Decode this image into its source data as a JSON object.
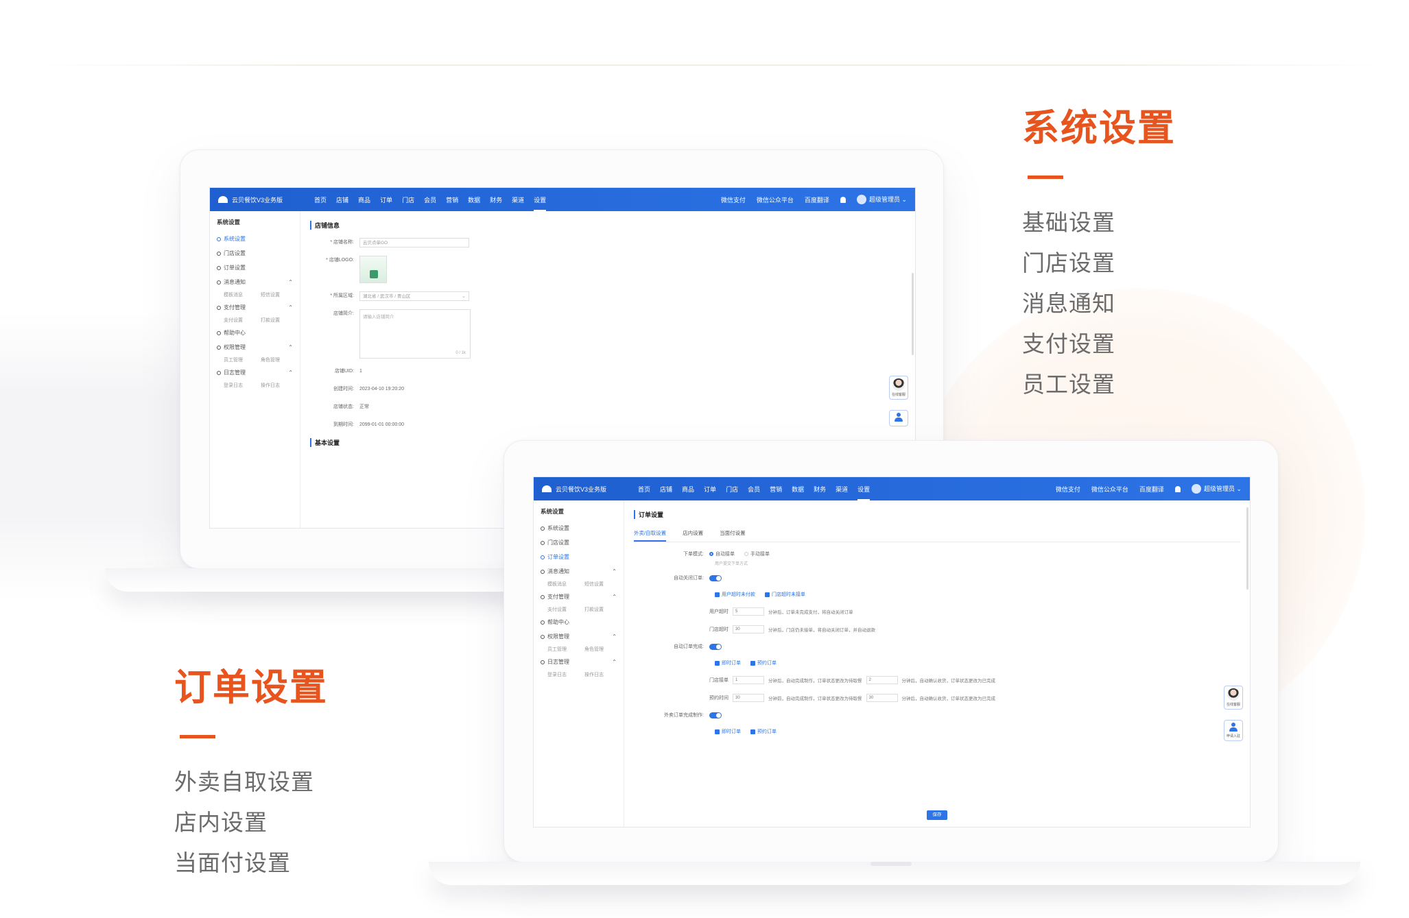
{
  "system_feature": {
    "title": "系统设置",
    "items": [
      "基础设置",
      "门店设置",
      "消息通知",
      "支付设置",
      "员工设置"
    ]
  },
  "order_feature": {
    "title": "订单设置",
    "items": [
      "外卖自取设置",
      "店内设置",
      "当面付设置"
    ]
  },
  "app": {
    "name": "云贝餐饮V3业务版",
    "menu": [
      "首页",
      "店铺",
      "商品",
      "订单",
      "门店",
      "会员",
      "营销",
      "数据",
      "财务",
      "渠道",
      "设置"
    ],
    "active_menu": "设置",
    "right_links": [
      "微信支付",
      "微信公众平台",
      "百度翻译"
    ],
    "user": "超级管理员",
    "accent_color": "#2d74e6",
    "brand_color": "#e8541e"
  },
  "sidebar": {
    "title": "系统设置",
    "items": [
      {
        "label": "系统设置",
        "icon": "circle-icon",
        "subs": []
      },
      {
        "label": "门店设置",
        "icon": "circle-icon",
        "subs": []
      },
      {
        "label": "订单设置",
        "icon": "circle-icon",
        "subs": []
      },
      {
        "label": "消息通知",
        "icon": "circle-icon",
        "subs": [
          "模板消息",
          "短信设置"
        ],
        "arrow": "⌃"
      },
      {
        "label": "支付管理",
        "icon": "circle-icon",
        "subs": [
          "支付设置",
          "打款设置"
        ],
        "arrow": "⌃"
      },
      {
        "label": "帮助中心",
        "icon": "circle-icon",
        "subs": []
      },
      {
        "label": "权限管理",
        "icon": "circle-icon",
        "subs": [
          "员工管理",
          "角色管理"
        ],
        "arrow": "⌃"
      },
      {
        "label": "日志管理",
        "icon": "circle-icon",
        "subs": [
          "登录日志",
          "操作日志"
        ],
        "arrow": "⌃"
      }
    ]
  },
  "shop_form": {
    "section1": "店铺信息",
    "name_label": "* 店铺名称:",
    "name_value": "云贝点单GO",
    "logo_label": "* 店铺LOGO:",
    "region_label": "* 所属区域:",
    "region_value": "湖北省 / 武汉市 / 青山区",
    "intro_label": "店铺简介:",
    "intro_placeholder": "请输入店铺简介",
    "intro_count": "0 / 1k",
    "id_label": "店铺UID:",
    "id_value": "1",
    "created_label": "创建时间:",
    "created_value": "2023-04-10 19:20:20",
    "status_label": "店铺状态:",
    "status_value": "正常",
    "expire_label": "到期时间:",
    "expire_value": "2099-01-01 00:00:00",
    "section2": "基本设置"
  },
  "order_form": {
    "section": "订单设置",
    "tabs": [
      "外卖/自取设置",
      "店内设置",
      "当面付设置"
    ],
    "order_mode_label": "下单模式:",
    "order_mode_options": [
      "自动接单",
      "手动接单"
    ],
    "order_mode_hint": "用户提交下单方式",
    "auto_close_label": "自动关闭订单:",
    "switch_on": "开",
    "close_checks": [
      "用户超时未付款",
      "门店超时未接单"
    ],
    "user_timeout_label": "用户超时",
    "user_timeout_value": "5",
    "user_timeout_hint": "分钟后，订单未完成支付，将自动关闭订单",
    "store_timeout_label": "门店超时",
    "store_timeout_value": "30",
    "store_timeout_hint": "分钟后，门店仍未接单，将自动关闭订单，并自动退款",
    "auto_deliver_label": "自动订单完成:",
    "deliver_checks": [
      "即时订单",
      "预约订单"
    ],
    "deliver_row1_label": "门店接单",
    "deliver_row1_value": "1",
    "deliver_row1_hint": "分钟后，自动完成制作，订单状态更改为待取餐",
    "deliver_row1_value2": "2",
    "deliver_row1_hint2": "分钟后，自动确认收货，订单状态更改为已完成",
    "deliver_row2_label": "预约时间",
    "deliver_row2_value": "30",
    "deliver_row2_hint": "分钟前，自动完成制作，订单状态更改为待取餐",
    "deliver_row2_value2": "30",
    "deliver_row2_hint2": "分钟后，自动确认收货，订单状态更改为已完成",
    "auto_make_label": "外卖订单完成制作:",
    "make_checks": [
      "即时订单",
      "预约订单"
    ],
    "save_label": "保存"
  },
  "float": {
    "service_label": "在线客服",
    "apply_label": "申请入驻"
  }
}
